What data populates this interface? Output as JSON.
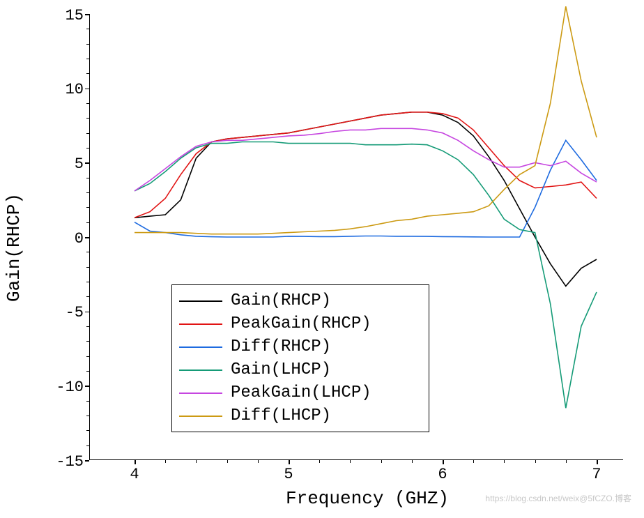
{
  "chart_data": {
    "type": "line",
    "x": [
      4.0,
      4.1,
      4.2,
      4.3,
      4.4,
      4.5,
      4.6,
      4.7,
      4.8,
      4.9,
      5.0,
      5.1,
      5.2,
      5.3,
      5.4,
      5.5,
      5.6,
      5.7,
      5.8,
      5.9,
      6.0,
      6.1,
      6.2,
      6.3,
      6.4,
      6.5,
      6.6,
      6.7,
      6.8,
      6.9,
      7.0
    ],
    "series": [
      {
        "name": "Gain(RHCP)",
        "color": "#000000",
        "values": [
          1.3,
          1.4,
          1.5,
          2.5,
          5.3,
          6.4,
          6.6,
          6.7,
          6.8,
          6.9,
          7.0,
          7.2,
          7.4,
          7.6,
          7.8,
          8.0,
          8.2,
          8.3,
          8.4,
          8.4,
          8.2,
          7.7,
          6.8,
          5.4,
          3.8,
          1.9,
          0.0,
          -1.8,
          -3.3,
          -2.1,
          -1.5
        ]
      },
      {
        "name": "PeakGain(RHCP)",
        "color": "#e11414",
        "values": [
          1.3,
          1.7,
          2.6,
          4.2,
          5.6,
          6.4,
          6.6,
          6.7,
          6.8,
          6.9,
          7.0,
          7.2,
          7.4,
          7.6,
          7.8,
          8.0,
          8.2,
          8.3,
          8.4,
          8.4,
          8.3,
          8.0,
          7.2,
          6.0,
          4.8,
          3.8,
          3.3,
          3.4,
          3.5,
          3.7,
          2.6
        ]
      },
      {
        "name": "Diff(RHCP)",
        "color": "#1e6be0",
        "values": [
          1.0,
          0.4,
          0.3,
          0.15,
          0.05,
          0.02,
          0.0,
          0.0,
          0.0,
          0.0,
          0.05,
          0.04,
          0.03,
          0.03,
          0.05,
          0.07,
          0.07,
          0.05,
          0.05,
          0.04,
          0.03,
          0.02,
          0.01,
          0.0,
          0.0,
          0.0,
          2.0,
          4.5,
          6.5,
          5.2,
          3.8
        ]
      },
      {
        "name": "Gain(LHCP)",
        "color": "#159b77",
        "values": [
          3.1,
          3.6,
          4.4,
          5.3,
          6.0,
          6.3,
          6.3,
          6.4,
          6.4,
          6.4,
          6.3,
          6.3,
          6.3,
          6.3,
          6.3,
          6.2,
          6.2,
          6.2,
          6.25,
          6.2,
          5.8,
          5.2,
          4.2,
          2.8,
          1.2,
          0.5,
          0.3,
          -4.5,
          -11.5,
          -6.0,
          -3.7
        ]
      },
      {
        "name": "PeakGain(LHCP)",
        "color": "#c646e0",
        "values": [
          3.1,
          3.8,
          4.6,
          5.4,
          6.1,
          6.4,
          6.5,
          6.5,
          6.6,
          6.7,
          6.8,
          6.85,
          6.95,
          7.1,
          7.2,
          7.2,
          7.3,
          7.3,
          7.3,
          7.2,
          7.0,
          6.5,
          5.8,
          5.2,
          4.7,
          4.7,
          5.0,
          4.8,
          5.1,
          4.3,
          3.7
        ]
      },
      {
        "name": "Diff(LHCP)",
        "color": "#cc9a13",
        "values": [
          0.3,
          0.3,
          0.3,
          0.3,
          0.25,
          0.2,
          0.2,
          0.2,
          0.2,
          0.25,
          0.3,
          0.35,
          0.4,
          0.45,
          0.55,
          0.7,
          0.9,
          1.1,
          1.2,
          1.4,
          1.5,
          1.6,
          1.7,
          2.1,
          3.2,
          4.2,
          4.8,
          9.0,
          15.5,
          10.5,
          6.7
        ]
      }
    ],
    "title": "",
    "xlabel": "Frequency (GHZ)",
    "ylabel": "Gain(RHCP)",
    "xlim": [
      4,
      7
    ],
    "ylim": [
      -15,
      15
    ],
    "legend_position": "lower-center"
  },
  "axes": {
    "y_ticks": [
      -15,
      -10,
      -5,
      0,
      5,
      10,
      15
    ],
    "x_ticks": [
      4,
      5,
      6,
      7
    ]
  },
  "watermark": "https://blog.csdn.net/weix@5fCZO.博客"
}
